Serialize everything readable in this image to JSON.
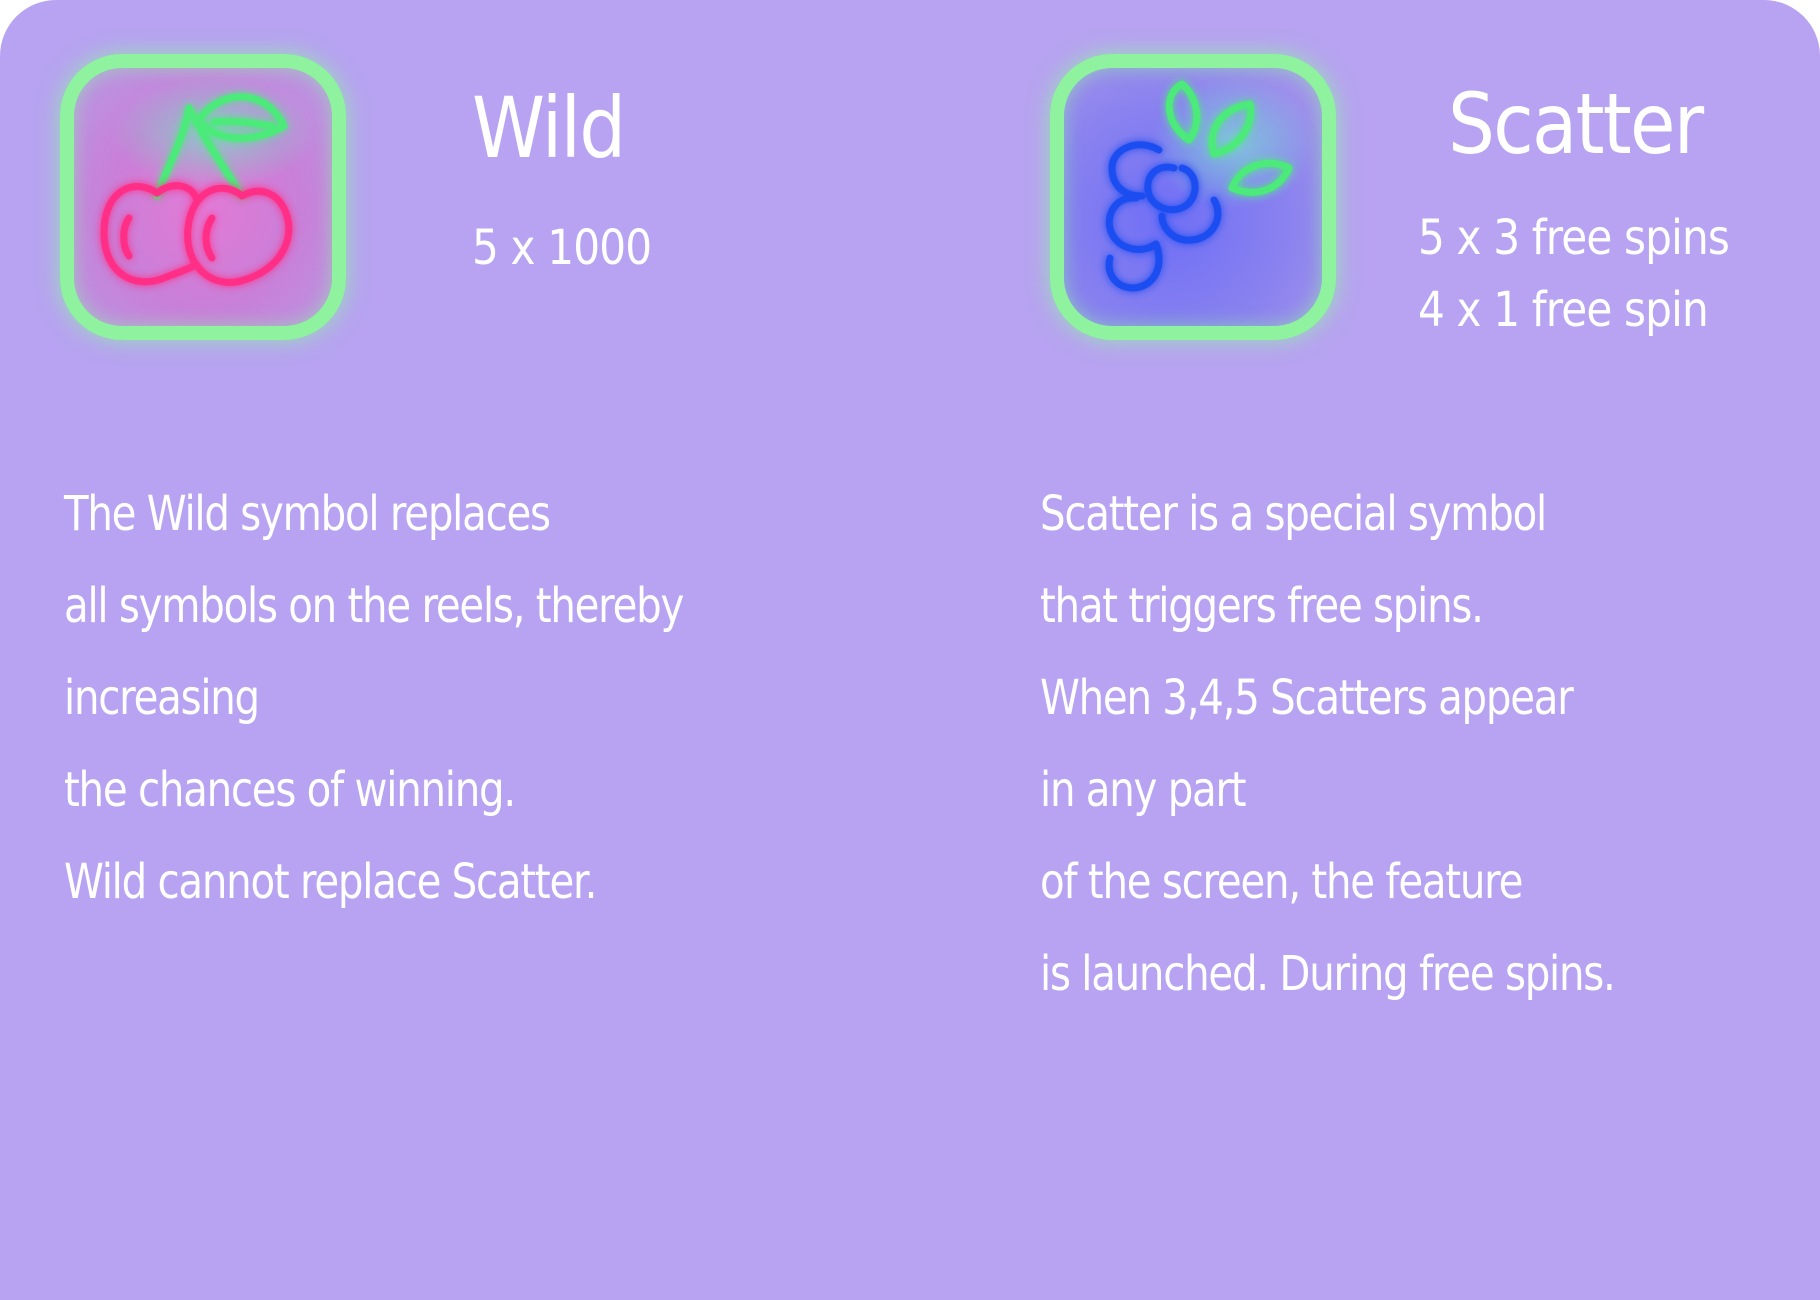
{
  "colors": {
    "panel_background": "#b7a3f1",
    "frame_border": "#8ef29f",
    "cherry_neon": "#ff2f86",
    "leaf_neon": "#4bea7a",
    "grape_neon": "#1c4df0",
    "text": "#ffffff"
  },
  "wild": {
    "icon": "cherry-icon",
    "title": "Wild",
    "payouts": [
      "5 x 1000"
    ],
    "description": [
      "The Wild symbol replaces",
      "all symbols on the reels, thereby",
      "increasing",
      "the chances of winning.",
      "Wild cannot replace Scatter."
    ]
  },
  "scatter": {
    "icon": "grapes-icon",
    "title": "Scatter",
    "payouts": [
      "5 x 3 free spins",
      "4 x 1 free spin"
    ],
    "description": [
      "Scatter is a special symbol",
      "that triggers free spins.",
      "When 3,4,5 Scatters appear",
      "in any part",
      "of the screen, the feature",
      "is launched. During free spins."
    ]
  }
}
